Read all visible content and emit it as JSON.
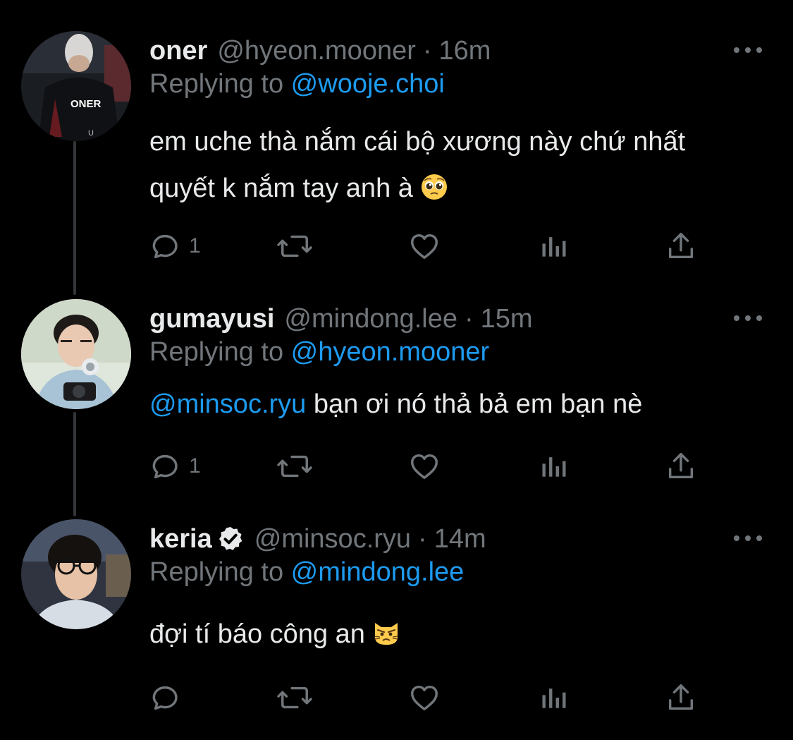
{
  "colors": {
    "background": "#000000",
    "text": "#e7e9ea",
    "muted": "#71767b",
    "link": "#1d9bf0",
    "thread_line": "#333639"
  },
  "tweets": [
    {
      "name": "oner",
      "handle": "@hyeon.mooner",
      "separator": "·",
      "time": "16m",
      "replying_label": "Replying to ",
      "replying_to": "@wooje.choi",
      "text_line1": "em uche thà nắm cái bộ xương này chứ nhất",
      "text_line2": "quyết k nắm tay anh à",
      "emoji": "pleading-face",
      "jersey_text": "ONER",
      "reply_count": "1",
      "icons": [
        "reply-icon",
        "retweet-icon",
        "like-icon",
        "views-icon",
        "share-icon"
      ]
    },
    {
      "name": "gumayusi",
      "handle": "@mindong.lee",
      "separator": "·",
      "time": "15m",
      "replying_label": "Replying to ",
      "replying_to": "@hyeon.mooner",
      "mention": "@minsoc.ryu",
      "text": " bạn ơi nó thả bả em bạn nè",
      "reply_count": "1",
      "icons": [
        "reply-icon",
        "retweet-icon",
        "like-icon",
        "views-icon",
        "share-icon"
      ]
    },
    {
      "name": "keria",
      "verified": true,
      "handle": "@minsoc.ryu",
      "separator": "·",
      "time": "14m",
      "replying_label": "Replying to ",
      "replying_to": "@mindong.lee",
      "text": "đợi tí báo công an ",
      "emoji": "pouting-cat",
      "reply_count": "",
      "icons": [
        "reply-icon",
        "retweet-icon",
        "like-icon",
        "views-icon",
        "share-icon"
      ]
    }
  ]
}
